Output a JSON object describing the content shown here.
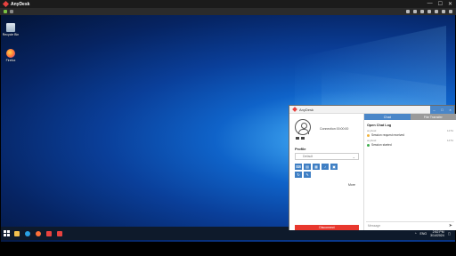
{
  "outer_window": {
    "title": "AnyDesk",
    "controls": [
      "—",
      "☐",
      "✕"
    ]
  },
  "desktop": {
    "icons": [
      {
        "name": "recycle-bin",
        "label": "Recycle Bin"
      },
      {
        "name": "firefox",
        "label": "Firefox"
      }
    ]
  },
  "taskbar": {
    "time": "2:52 PM",
    "date": "3/14/2024",
    "tray_labels": [
      "ENG",
      "US"
    ]
  },
  "anydesk": {
    "title": "AnyDesk",
    "connection_text": "Connection 00:00:00",
    "profile_label": "Profile",
    "profile_value": "Default",
    "more_label": "More",
    "disconnect_label": "Disconnect",
    "tabs": [
      "Chat",
      "File Transfer"
    ],
    "chat_log_title": "Open Chat Log",
    "messages": [
      {
        "time": "anydesk",
        "time2": "14:51",
        "text": "Session request received",
        "kind": "warn"
      },
      {
        "time": "anydesk",
        "time2": "14:51",
        "text": "Session started",
        "kind": "ok"
      }
    ],
    "message_placeholder": "Message"
  },
  "colors": {
    "accent": "#4a86c8",
    "brand": "#e8423f",
    "disconnect": "#e8382e"
  }
}
